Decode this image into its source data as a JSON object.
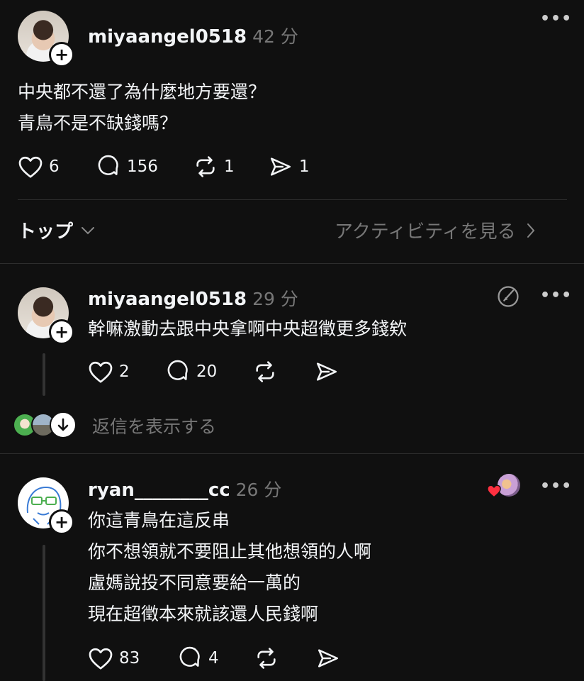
{
  "post": {
    "username": "miyaangel0518",
    "time": "42 分",
    "lines": [
      "中央都不還了為什麼地方要還？",
      "青鳥不是不缺錢嗎？"
    ],
    "likes": "6",
    "replies": "156",
    "reposts": "1",
    "shares": "1"
  },
  "sort_bar": {
    "sort_label": "トップ",
    "activity_link": "アクティビティを見る"
  },
  "comments": [
    {
      "username": "miyaangel0518",
      "time": "29 分",
      "lines": [
        "幹嘛激動去跟中央拿啊中央超徵更多錢欸"
      ],
      "likes": "2",
      "replies": "20",
      "show_replies": "返信を表示する"
    },
    {
      "username": "ryan________cc",
      "time": "26 分",
      "lines": [
        "你這青鳥在這反串",
        "你不想領就不要阻止其他想領的人啊",
        "盧媽說投不同意要給一萬的",
        "現在超徵本來就該還人民錢啊"
      ],
      "likes": "83",
      "replies": "4"
    }
  ],
  "colors": {
    "background": "#101010",
    "text": "#f3f5f7",
    "muted": "#777777",
    "heart": "#ff3040"
  }
}
